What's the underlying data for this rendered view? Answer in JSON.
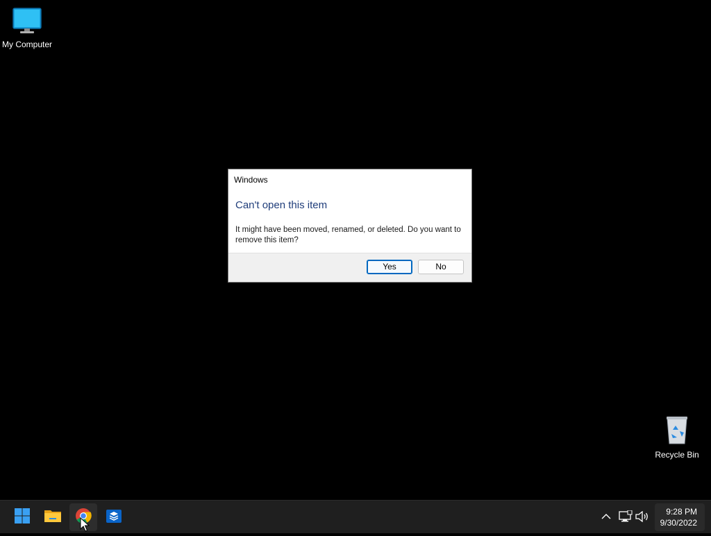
{
  "desktop": {
    "icons": [
      {
        "label": "My Computer",
        "icon": "monitor-icon"
      },
      {
        "label": "Recycle Bin",
        "icon": "recycle-bin-icon"
      }
    ]
  },
  "dialog": {
    "title": "Windows",
    "heading": "Can't open this item",
    "message": "It might have been moved, renamed, or deleted. Do you want to remove this item?",
    "yes_label": "Yes",
    "no_label": "No",
    "heading_color": "#1f3d7a",
    "default_button_border": "#0067c0"
  },
  "taskbar": {
    "apps": [
      {
        "icon": "windows-start-icon"
      },
      {
        "icon": "file-explorer-icon"
      },
      {
        "icon": "chrome-icon",
        "active": true
      },
      {
        "icon": "store-icon"
      }
    ],
    "tray": {
      "icons": [
        "chevron-up-icon",
        "network-icon",
        "volume-icon"
      ]
    },
    "clock": {
      "time": "9:28 PM",
      "date": "9/30/2022"
    }
  },
  "colors": {
    "desktop_background": "#000000",
    "taskbar_background": "#1f1f1f"
  }
}
